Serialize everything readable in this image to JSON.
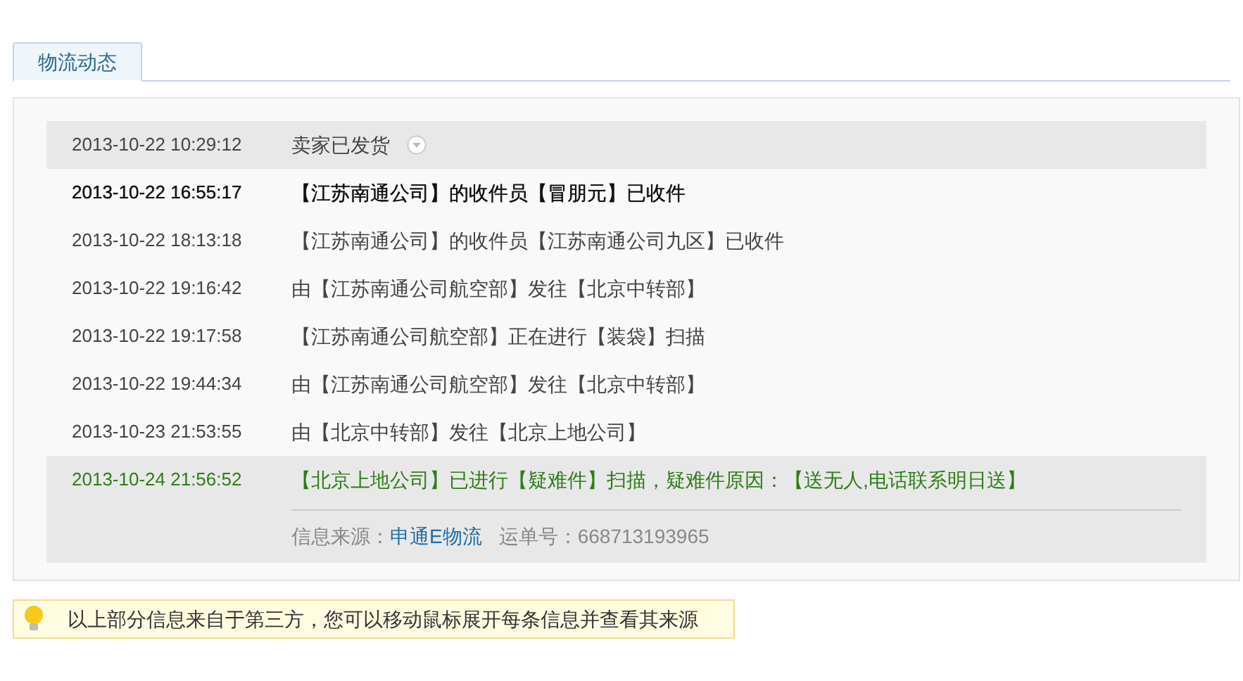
{
  "tabs": [
    {
      "label": "物流动态",
      "selected": true
    }
  ],
  "events": [
    {
      "time": "2013-10-22 10:29:12",
      "text": "卖家已发货",
      "highlighted": true,
      "hovered": false,
      "latest": false,
      "toggle": true
    },
    {
      "time": "2013-10-22 16:55:17",
      "text": "【江苏南通公司】的收件员【冒朋元】已收件",
      "highlighted": false,
      "hovered": true,
      "latest": false,
      "toggle": false
    },
    {
      "time": "2013-10-22 18:13:18",
      "text": "【江苏南通公司】的收件员【江苏南通公司九区】已收件",
      "highlighted": false,
      "hovered": false,
      "latest": false,
      "toggle": false
    },
    {
      "time": "2013-10-22 19:16:42",
      "text": "由【江苏南通公司航空部】发往【北京中转部】",
      "highlighted": false,
      "hovered": false,
      "latest": false,
      "toggle": false
    },
    {
      "time": "2013-10-22 19:17:58",
      "text": "【江苏南通公司航空部】正在进行【装袋】扫描",
      "highlighted": false,
      "hovered": false,
      "latest": false,
      "toggle": false
    },
    {
      "time": "2013-10-22 19:44:34",
      "text": "由【江苏南通公司航空部】发往【北京中转部】",
      "highlighted": false,
      "hovered": false,
      "latest": false,
      "toggle": false
    },
    {
      "time": "2013-10-23 21:53:55",
      "text": "由【北京中转部】发往【北京上地公司】",
      "highlighted": false,
      "hovered": false,
      "latest": false,
      "toggle": false
    },
    {
      "time": "2013-10-24 21:56:52",
      "text": "【北京上地公司】已进行【疑难件】扫描，疑难件原因：【送无人,电话联系明日送】",
      "highlighted": true,
      "hovered": false,
      "latest": true,
      "toggle": false,
      "source": {
        "label": "信息来源：",
        "link": "申通E物流",
        "waybill": "运单号：668713193965"
      }
    }
  ],
  "tip": "以上部分信息来自于第三方，您可以移动鼠标展开每条信息并查看其来源"
}
